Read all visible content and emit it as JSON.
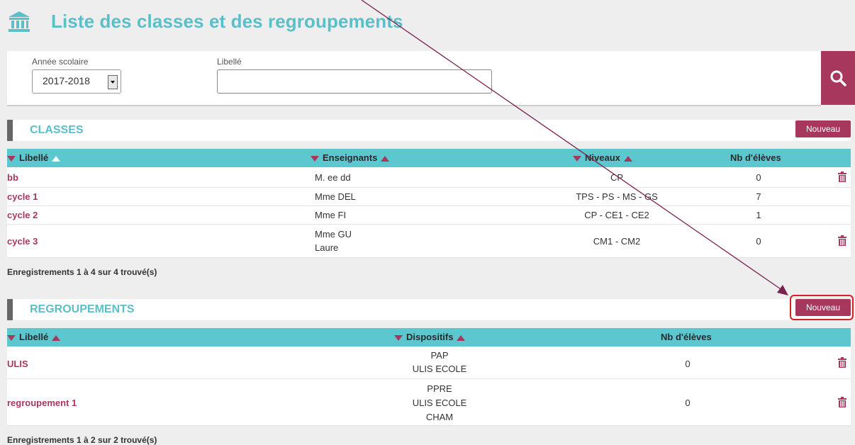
{
  "header": {
    "title": "Liste des classes et des regroupements",
    "icon": "building-icon"
  },
  "search": {
    "year_label": "Année scolaire",
    "year_value": "2017-2018",
    "libelle_label": "Libellé",
    "libelle_value": "",
    "search_icon": "search-icon"
  },
  "classes": {
    "title": "CLASSES",
    "new_label": "Nouveau",
    "columns": [
      "Libellé",
      "Enseignants",
      "Niveaux",
      "Nb d'élèves"
    ],
    "rows": [
      {
        "libelle": "bb",
        "enseignants": [
          "M. ee dd"
        ],
        "niveaux": "CP",
        "nb": "0",
        "deletable": true
      },
      {
        "libelle": "cycle 1",
        "enseignants": [
          "Mme DEL"
        ],
        "niveaux": "TPS - PS - MS - GS",
        "nb": "7",
        "deletable": false
      },
      {
        "libelle": "cycle 2",
        "enseignants": [
          "Mme FI"
        ],
        "niveaux": "CP - CE1 - CE2",
        "nb": "1",
        "deletable": false
      },
      {
        "libelle": "cycle 3",
        "enseignants": [
          "Mme GU",
          "Laure"
        ],
        "niveaux": "CM1 - CM2",
        "nb": "0",
        "deletable": true
      }
    ],
    "footer": "Enregistrements 1 à 4 sur 4 trouvé(s)"
  },
  "regroupements": {
    "title": "REGROUPEMENTS",
    "new_label": "Nouveau",
    "columns": [
      "Libellé",
      "Dispositifs",
      "Nb d'élèves"
    ],
    "rows": [
      {
        "libelle": "ULIS",
        "dispositifs": [
          "PAP",
          "ULIS ECOLE"
        ],
        "nb": "0",
        "deletable": true
      },
      {
        "libelle": "regroupement 1",
        "dispositifs": [
          "PPRE",
          "ULIS ECOLE",
          "CHAM"
        ],
        "nb": "0",
        "deletable": true
      }
    ],
    "footer": "Enregistrements 1 à 2 sur 2 trouvé(s)"
  },
  "colors": {
    "accent": "#a8375e",
    "teal": "#5bbfc9",
    "header_bg": "#5dc7d0",
    "annotation_red": "#d81f2a",
    "arrow": "#7a2150"
  }
}
